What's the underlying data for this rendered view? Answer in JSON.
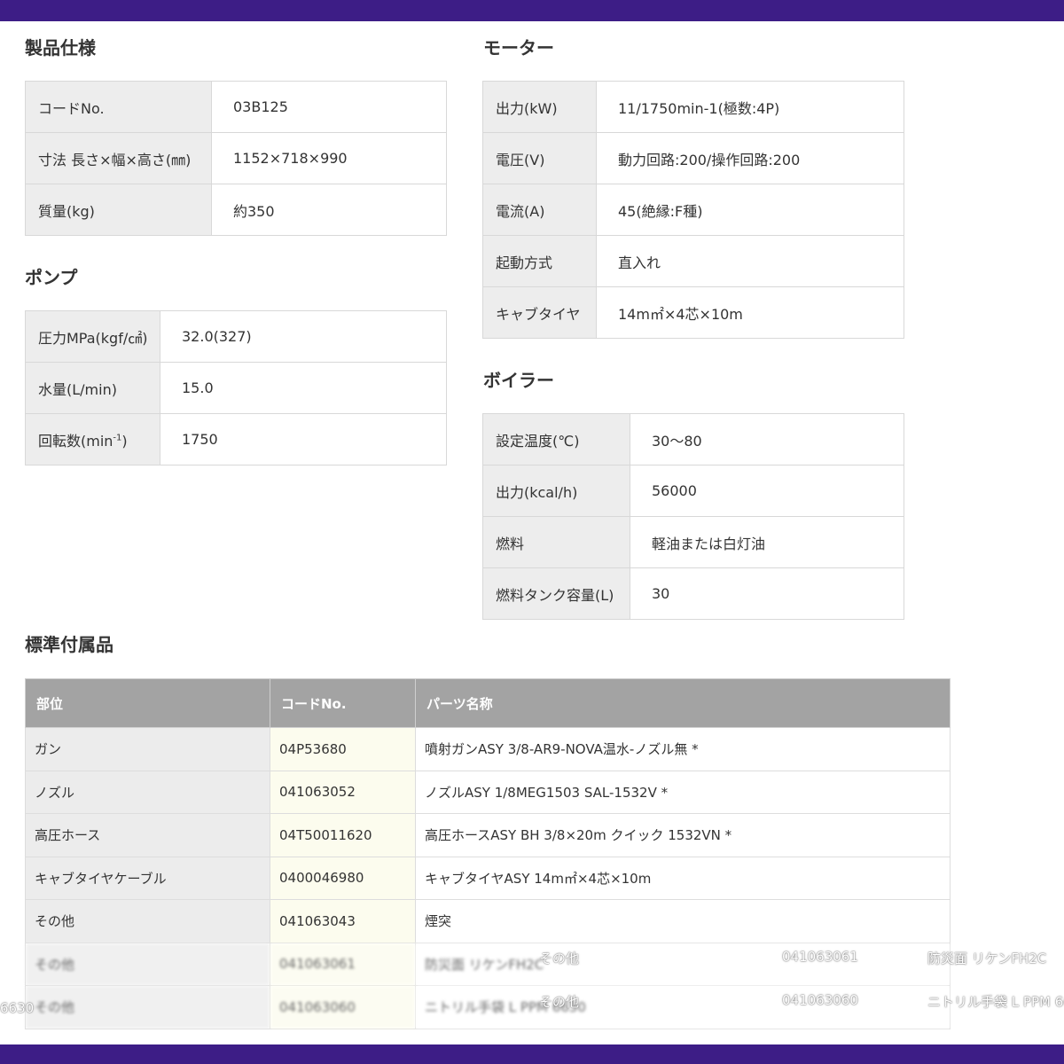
{
  "spec": {
    "title": "製品仕様",
    "rows": [
      {
        "label": "コードNo.",
        "value": "03B125"
      },
      {
        "label": "寸法 長さ×幅×高さ(㎜)",
        "value": "1152×718×990"
      },
      {
        "label": "質量(kg)",
        "value": "約350"
      }
    ]
  },
  "pump": {
    "title": "ポンプ",
    "rows": [
      {
        "label": "圧力MPa(kgf/㎠)",
        "value": "32.0(327)"
      },
      {
        "label": "水量(L/min)",
        "value": "15.0"
      },
      {
        "label": "回転数(min",
        "sup": "-1",
        "label_end": ")",
        "value": "1750"
      }
    ]
  },
  "motor": {
    "title": "モーター",
    "rows": [
      {
        "label": "出力(kW)",
        "value": "11/1750min-1(極数:4P)"
      },
      {
        "label": "電圧(V)",
        "value": "動力回路:200/操作回路:200"
      },
      {
        "label": "電流(A)",
        "value": "45(絶縁:F種)"
      },
      {
        "label": "起動方式",
        "value": "直入れ"
      },
      {
        "label": "キャブタイヤ",
        "value": "14m㎡×4芯×10m"
      }
    ]
  },
  "boiler": {
    "title": "ボイラー",
    "rows": [
      {
        "label": "設定温度(℃)",
        "value": "30〜80"
      },
      {
        "label": "出力(kcal/h)",
        "value": "56000"
      },
      {
        "label": "燃料",
        "value": "軽油または白灯油"
      },
      {
        "label": "燃料タンク容量(L)",
        "value": "30"
      }
    ]
  },
  "accessories": {
    "title": "標準付属品",
    "headers": [
      "部位",
      "コードNo.",
      "パーツ名称"
    ],
    "rows": [
      [
        "ガン",
        "04P53680",
        "噴射ガンASY 3/8-AR9-NOVA温水-ノズル無 *"
      ],
      [
        "ノズル",
        "041063052",
        "ノズルASY 1/8MEG1503 SAL-1532V *"
      ],
      [
        "高圧ホース",
        "04T50011620",
        "高圧ホースASY BH 3/8×20m クイック 1532VN *"
      ],
      [
        "キャブタイヤケーブル",
        "0400046980",
        "キャブタイヤASY 14m㎡×4芯×10m"
      ],
      [
        "その他",
        "041063043",
        "煙突"
      ],
      [
        "その他",
        "041063061",
        "防災面 リケンFH2C"
      ],
      [
        "その他",
        "041063060",
        "ニトリル手袋 L PPM 6630"
      ]
    ]
  },
  "ghost_rows": [
    [
      "その他",
      "041063061",
      "防災面 リケンFH2C"
    ],
    [
      "その他",
      "041063060",
      "ニトリル手袋 L PPM 6630"
    ]
  ],
  "ghost_fragment": "6630"
}
